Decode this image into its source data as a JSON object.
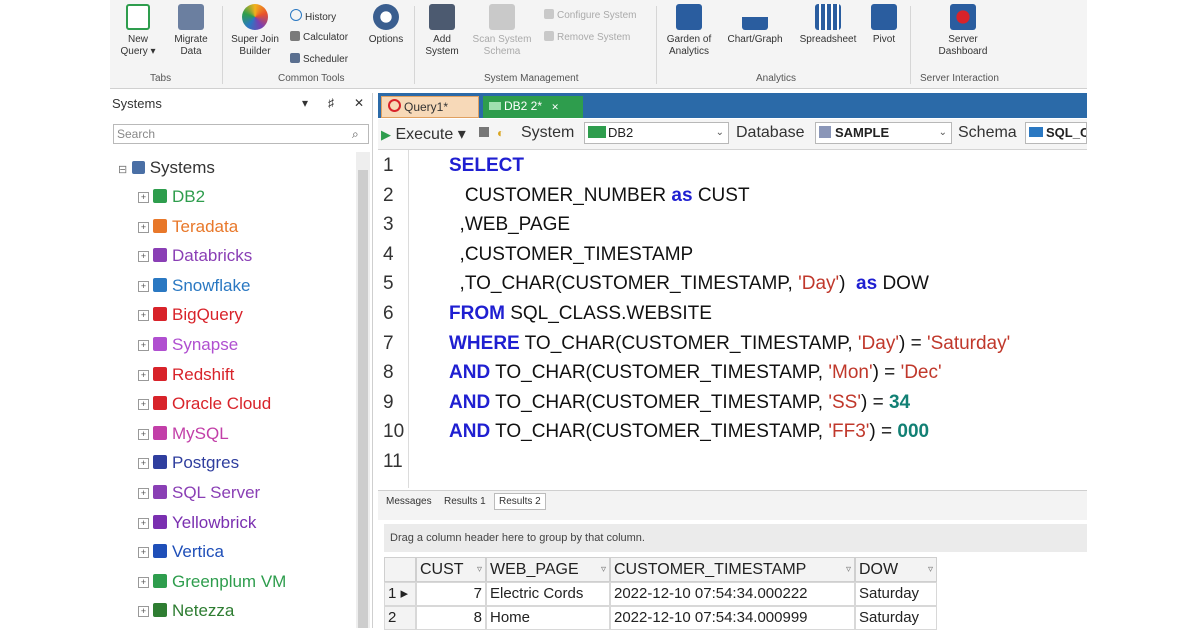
{
  "ribbon": {
    "new_query": "New\nQuery ▾",
    "migrate_data": "Migrate\nData",
    "tabs_group": "Tabs",
    "super_join": "Super Join\nBuilder",
    "history": "History",
    "calculator": "Calculator",
    "scheduler": "Scheduler",
    "options": "Options",
    "common_tools_group": "Common Tools",
    "add_system": "Add\nSystem",
    "scan_system": "Scan System\nSchema",
    "configure_system": "Configure System",
    "remove_system": "Remove System",
    "system_mgmt_group": "System Management",
    "garden": "Garden of\nAnalytics",
    "chart_graph": "Chart/Graph",
    "spreadsheet": "Spreadsheet",
    "pivot": "Pivot",
    "analytics_group": "Analytics",
    "server_dashboard": "Server\nDashboard",
    "server_interaction_group": "Server Interaction"
  },
  "left_panel": {
    "title": "Systems",
    "pin": "▾",
    "dock": "♯",
    "close": "✕",
    "search_placeholder": "Search",
    "root": "Systems",
    "systems": [
      {
        "label": "DB2",
        "color": "#2e9d4d"
      },
      {
        "label": "Teradata",
        "color": "#e8782a"
      },
      {
        "label": "Databricks",
        "color": "#8a3fb5"
      },
      {
        "label": "Snowflake",
        "color": "#2a78c2"
      },
      {
        "label": "BigQuery",
        "color": "#d8232a"
      },
      {
        "label": "Synapse",
        "color": "#b04fd0"
      },
      {
        "label": "Redshift",
        "color": "#d8232a"
      },
      {
        "label": "Oracle Cloud",
        "color": "#d8232a"
      },
      {
        "label": "MySQL",
        "color": "#c23fa8"
      },
      {
        "label": "Postgres",
        "color": "#2f3e9e"
      },
      {
        "label": "SQL Server",
        "color": "#8a3fb5"
      },
      {
        "label": "Yellowbrick",
        "color": "#7a2fb0"
      },
      {
        "label": "Vertica",
        "color": "#1f4fb8"
      },
      {
        "label": "Greenplum VM",
        "color": "#2e9d4d"
      },
      {
        "label": "Netezza",
        "color": "#2e7d32"
      }
    ]
  },
  "tabs": {
    "query1": "Query1*",
    "db2": "DB2 2*",
    "db2_close": "✕"
  },
  "toolbar": {
    "execute": "Execute ▾",
    "system_label": "System",
    "system_value": "DB2",
    "database_label": "Database",
    "database_value": "SAMPLE",
    "schema_label": "Schema",
    "schema_value": "SQL_C"
  },
  "editor": {
    "line_numbers": [
      "1",
      "2",
      "3",
      "4",
      "5",
      "6",
      "7",
      "8",
      "9",
      "10",
      "11"
    ],
    "lines": [
      {
        "parts": [
          {
            "t": "SELECT",
            "c": "kw"
          }
        ]
      },
      {
        "parts": [
          {
            "t": "   CUSTOMER_NUMBER ",
            "c": ""
          },
          {
            "t": "as",
            "c": "kw"
          },
          {
            "t": " CUST",
            "c": ""
          }
        ]
      },
      {
        "parts": [
          {
            "t": "  ,WEB_PAGE",
            "c": ""
          }
        ]
      },
      {
        "parts": [
          {
            "t": "  ,CUSTOMER_TIMESTAMP",
            "c": ""
          }
        ]
      },
      {
        "parts": [
          {
            "t": "  ,TO_CHAR(CUSTOMER_TIMESTAMP, ",
            "c": ""
          },
          {
            "t": "'Day'",
            "c": "str"
          },
          {
            "t": ")  ",
            "c": ""
          },
          {
            "t": "as",
            "c": "kw"
          },
          {
            "t": " DOW",
            "c": ""
          }
        ]
      },
      {
        "parts": [
          {
            "t": "FROM",
            "c": "kw"
          },
          {
            "t": " SQL_CLASS.WEBSITE",
            "c": ""
          }
        ]
      },
      {
        "parts": [
          {
            "t": "WHERE",
            "c": "kw"
          },
          {
            "t": " TO_CHAR(CUSTOMER_TIMESTAMP, ",
            "c": ""
          },
          {
            "t": "'Day'",
            "c": "str"
          },
          {
            "t": ") = ",
            "c": ""
          },
          {
            "t": "'Saturday'",
            "c": "str"
          }
        ]
      },
      {
        "parts": [
          {
            "t": "AND",
            "c": "kw"
          },
          {
            "t": " TO_CHAR(CUSTOMER_TIMESTAMP, ",
            "c": ""
          },
          {
            "t": "'Mon'",
            "c": "str"
          },
          {
            "t": ") = ",
            "c": ""
          },
          {
            "t": "'Dec'",
            "c": "str"
          }
        ]
      },
      {
        "parts": [
          {
            "t": "AND",
            "c": "kw"
          },
          {
            "t": " TO_CHAR(CUSTOMER_TIMESTAMP, ",
            "c": ""
          },
          {
            "t": "'SS'",
            "c": "str"
          },
          {
            "t": ") = ",
            "c": ""
          },
          {
            "t": "34",
            "c": "num"
          }
        ]
      },
      {
        "parts": [
          {
            "t": "AND",
            "c": "kw"
          },
          {
            "t": " TO_CHAR(CUSTOMER_TIMESTAMP, ",
            "c": ""
          },
          {
            "t": "'FF3'",
            "c": "str"
          },
          {
            "t": ") = ",
            "c": ""
          },
          {
            "t": "000",
            "c": "num"
          }
        ]
      },
      {
        "parts": []
      }
    ]
  },
  "results": {
    "tabs": [
      "Messages",
      "Results 1",
      "Results 2"
    ],
    "group_hint": "Drag a column header here to group by that column.",
    "columns": [
      "CUST",
      "WEB_PAGE",
      "CUSTOMER_TIMESTAMP",
      "DOW"
    ],
    "rows": [
      {
        "num": "1",
        "cells": [
          "7",
          "Electric Cords",
          "2022-12-10 07:54:34.000222",
          "Saturday"
        ]
      },
      {
        "num": "2",
        "cells": [
          "8",
          "Home",
          "2022-12-10 07:54:34.000999",
          "Saturday"
        ]
      }
    ]
  }
}
